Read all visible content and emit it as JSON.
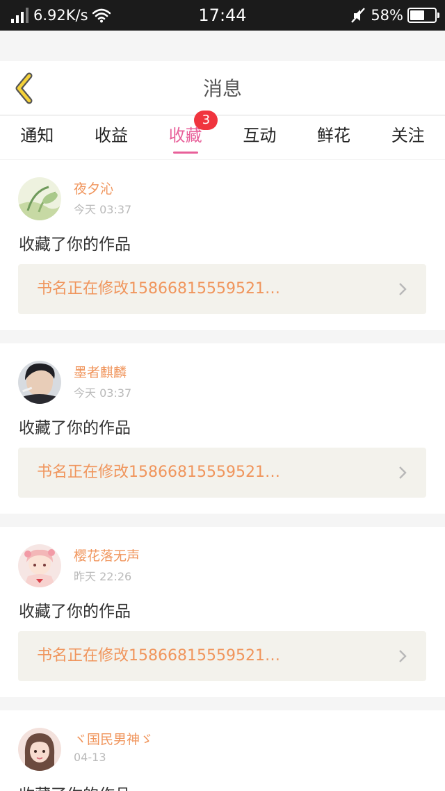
{
  "status_bar": {
    "net_speed": "6.92K/s",
    "time": "17:44",
    "battery": "58%",
    "battery_level": 0.58
  },
  "header": {
    "title": "消息",
    "back_icon": "chevron-left-icon"
  },
  "tabs": [
    {
      "label": "通知"
    },
    {
      "label": "收益"
    },
    {
      "label": "收藏",
      "badge": "3",
      "active": true
    },
    {
      "label": "互动"
    },
    {
      "label": "鲜花"
    },
    {
      "label": "关注"
    }
  ],
  "notifications": [
    {
      "user": "夜夕沁",
      "time": "今天 03:37",
      "action": "收藏了你的作品",
      "work": "书名正在修改15866815559521…"
    },
    {
      "user": "墨者麒麟",
      "time": "今天 03:37",
      "action": "收藏了你的作品",
      "work": "书名正在修改15866815559521…"
    },
    {
      "user": "樱花落无声",
      "time": "昨天 22:26",
      "action": "收藏了你的作品",
      "work": "书名正在修改15866815559521…"
    },
    {
      "user": "ヾ国民男神ゞ",
      "time": "04-13",
      "action": "收藏了你的作品"
    }
  ],
  "colors": {
    "accent_pink": "#e8609a",
    "username_orange": "#f0955c",
    "badge_red": "#f0343e",
    "back_yellow": "#f5d23a"
  }
}
